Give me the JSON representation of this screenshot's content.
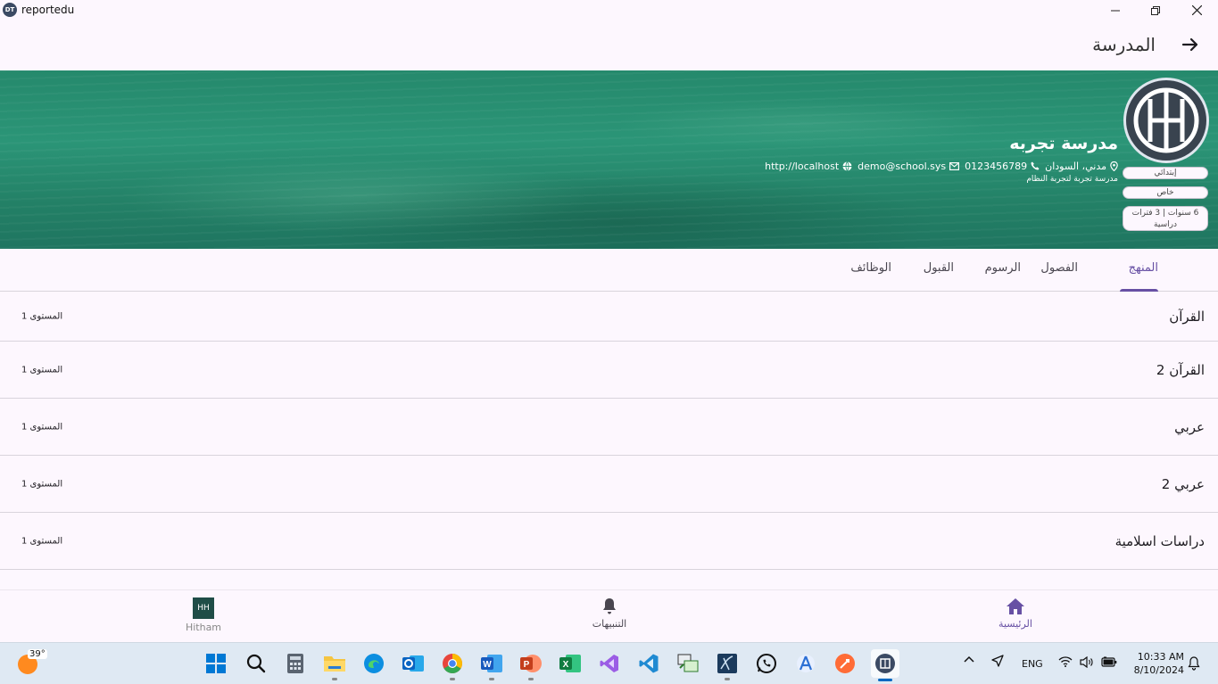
{
  "window": {
    "title": "reportedu",
    "app_icon_text": "DT"
  },
  "appbar": {
    "title": "المدرسة"
  },
  "school": {
    "logo_text": "HH",
    "name": "مدرسة تجربه",
    "location": "مدني، السودان",
    "phone": "0123456789",
    "email": "demo@school.sys",
    "website": "http://localhost",
    "subtitle": "مدرسة تجربة لتجربة النظام",
    "chips": [
      "إبتدائي",
      "خاص",
      "6 سنوات | 3 فترات دراسية"
    ]
  },
  "tabs": [
    {
      "label": "المنهج",
      "active": true
    },
    {
      "label": "الفصول",
      "active": false
    },
    {
      "label": "الرسوم",
      "active": false
    },
    {
      "label": "القبول",
      "active": false
    },
    {
      "label": "الوظائف",
      "active": false
    }
  ],
  "subjects": [
    {
      "title": "القرآن",
      "level": "المستوى 1"
    },
    {
      "title": "القرآن 2",
      "level": "المستوى 1"
    },
    {
      "title": "عربي",
      "level": "المستوى 1"
    },
    {
      "title": "عربي 2",
      "level": "المستوى 1"
    },
    {
      "title": "دراسات اسلامية",
      "level": "المستوى 1"
    }
  ],
  "bottom_nav": {
    "home": "الرئيسية",
    "notifications": "التنبيهات",
    "profile_initials": "HH",
    "profile_name": "Hitham"
  },
  "taskbar": {
    "temperature": "39°",
    "language": "ENG",
    "time": "10:33 AM",
    "date": "8/10/2024",
    "apps": [
      "start-icon",
      "search-icon",
      "calculator-icon",
      "file-explorer-icon",
      "edge-icon",
      "outlook-icon",
      "chrome-icon",
      "word-icon",
      "powerpoint-icon",
      "excel-icon",
      "visual-studio-icon",
      "vscode-icon",
      "remote-desktop-icon",
      "sql-server-icon",
      "whatsapp-icon",
      "android-studio-icon",
      "postman-icon",
      "reportedu-icon"
    ]
  },
  "colors": {
    "primary": "#6750a4",
    "banner": "#2b9577",
    "surface": "#fdf7fe"
  }
}
